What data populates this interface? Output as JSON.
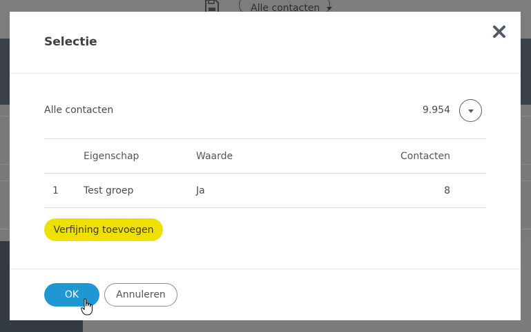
{
  "background": {
    "view_selector_label": "Alle contacten",
    "save_icon": "floppy-disk-icon"
  },
  "dialog": {
    "title": "Selectie",
    "close_icon": "close-icon",
    "summary": {
      "label": "Alle contacten",
      "count": "9.954",
      "expand_icon": "chevron-down-icon"
    },
    "table": {
      "columns": [
        "",
        "Eigenschap",
        "Waarde",
        "Contacten"
      ],
      "rows": [
        {
          "index": "1",
          "property": "Test groep",
          "value": "Ja",
          "contacts": "8"
        }
      ]
    },
    "refine_button": "Verfijning toevoegen",
    "ok_button": "OK",
    "cancel_button": "Annuleren"
  },
  "colors": {
    "accent_blue": "#1f97d3",
    "accent_yellow": "#efe000",
    "overlay": "#6e6e6e"
  }
}
